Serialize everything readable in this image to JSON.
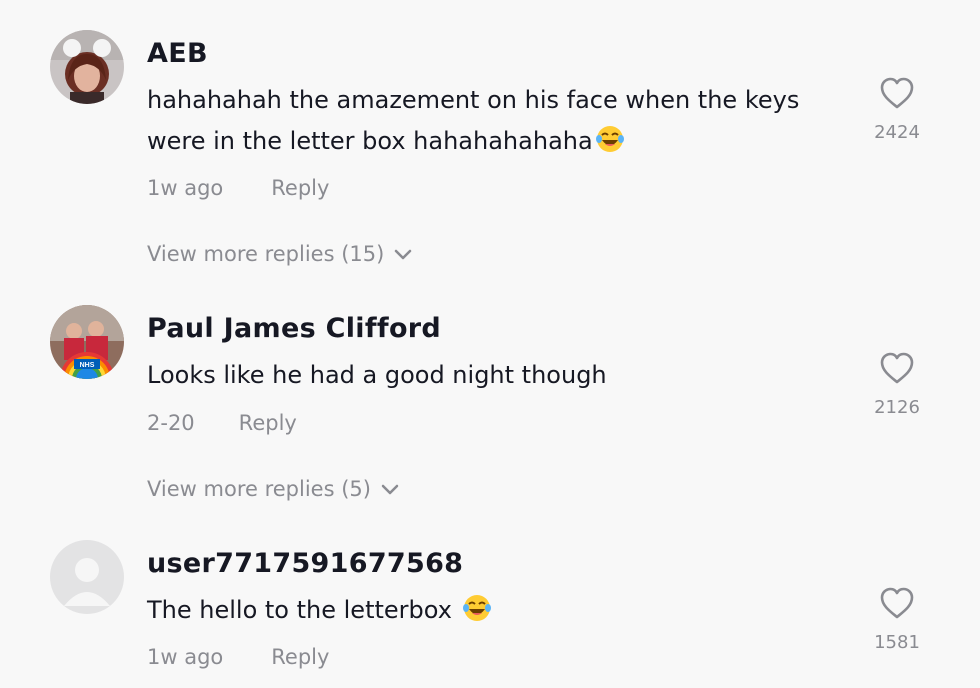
{
  "comments": [
    {
      "username": "AEB",
      "text": "hahahahah the amazement on his face when the keys were in the letter box hahahahahaha",
      "time": "1w ago",
      "reply_label": "Reply",
      "view_more": "View more replies (15)",
      "likes": "2424",
      "avatar_icon": "profile-photo",
      "emoji_icon": "laughing-tears-emoji"
    },
    {
      "username": "Paul James Clifford",
      "text": "Looks like he had a good night though",
      "time": "2-20",
      "reply_label": "Reply",
      "view_more": "View more replies (5)",
      "likes": "2126",
      "avatar_icon": "profile-photo",
      "avatar_badge": "NHS"
    },
    {
      "username": "user7717591677568",
      "text": "The hello to the letterbox",
      "time": "1w ago",
      "reply_label": "Reply",
      "likes": "1581",
      "avatar_icon": "default-avatar",
      "emoji_icon": "laughing-tears-emoji"
    }
  ],
  "colors": {
    "background": "#f8f8f8",
    "primary_text": "#161823",
    "secondary_text": "#8a8b91"
  }
}
